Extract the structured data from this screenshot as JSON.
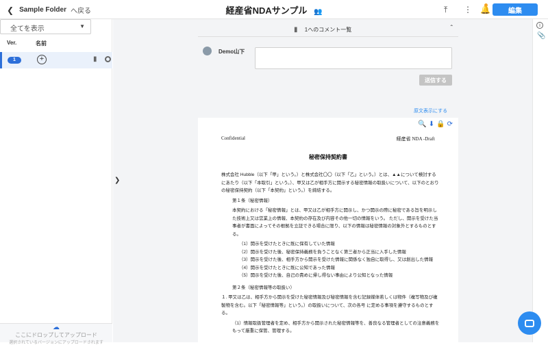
{
  "topbar": {
    "folder": "Sample Folder",
    "return_label": "へ戻る",
    "title": "経産省NDAサンプル",
    "people_icon": "people-icon",
    "upload_icon": "upload-icon",
    "more_icon": "more-vertical-icon",
    "bell_icon": "bell-icon",
    "edit_label": "編集"
  },
  "sidebar": {
    "filter_value": "全てを表示",
    "columns": {
      "ver": "Ver.",
      "name": "名前"
    },
    "versions": [
      {
        "number": "1"
      }
    ],
    "drop_title": "ここにドロップしてアップロード",
    "drop_sub": "選択されているバージョンにアップロードされます"
  },
  "comments": {
    "header": "1へのコメント一覧",
    "user": "Demo山下",
    "send_label": "送信する",
    "original_link": "原文表示にする"
  },
  "document": {
    "confidential": "Confidential",
    "draft": "経産省 NDA -Draft",
    "title": "秘密保持契約書",
    "intro": "株式会社 Hubble（以下「甲」という。）と株式会社〇〇（以下「乙」という。）とは、▲▲について検討するにあたり（以下「本取引」という。）、甲又は乙が相手方に開示する秘密情報の取扱いについて、以下のとおりの秘密保持契約（以下「本契約」という。）を締結する。",
    "art1_title": "第１条（秘密情報）",
    "art1_body": "本契約における「秘密情報」とは、甲又は乙が相手方に開示し、かつ開示の際に秘密である旨を明示した技術上又は営業上の情報、本契約の存在及び内容その他一切の情報をいう。 ただし、開示を受けた当事者が書面によってその根拠を立証できる場合に限り、以下の情報は秘密情報の対象外とするものとする。",
    "art1_items": [
      "（1）開示を受けたときに既に保有していた情報",
      "（2）開示を受けた後、秘密保持義務を負うことなく第三者から正当に入手した情報",
      "（3）開示を受けた後、相手方から開示を受けた情報に関係なく独自に取得し、又は創出した情報",
      "（4）開示を受けたときに既に公知であった情報",
      "（5）開示を受けた後、自己の責めに帰し得ない事由により公知となった情報"
    ],
    "art2_title": "第２条（秘密情報等の取扱い）",
    "art2_body": "１. 甲又は乙は、相手方から開示を受けた秘密情報及び秘密情報を含む記録媒体若しくは物件（複写物及び複製物を含む。以下「秘密情報等」という。）の取扱いについて、次の各号 に定める事項を遵守するものとする。",
    "art2_item1": "（1）情報取扱管理者を定め、相手方から開示された秘密情報等を、善良なる管理者としての注意義務をもって厳重に保管、管理する。"
  }
}
